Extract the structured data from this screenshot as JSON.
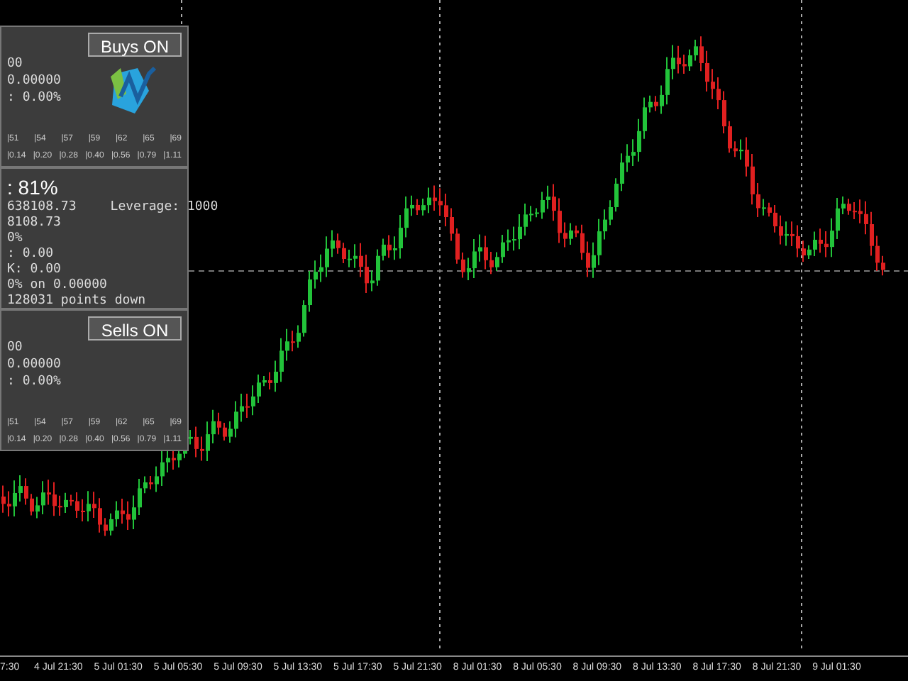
{
  "panels": [
    {
      "kind": "levels",
      "button": "Buys ON",
      "lines": [
        "00",
        "0.00000",
        ": 0.00%"
      ],
      "levels": [
        "|51",
        "|54",
        "|57",
        "|59",
        "|62",
        "|65",
        "|69"
      ],
      "values": [
        "|0.14",
        "|0.20",
        "|0.28",
        "|0.40",
        "|0.56",
        "|0.79",
        "|1.11"
      ]
    },
    {
      "kind": "account",
      "headline": ": 81%",
      "leverage": "Leverage: 1000",
      "lines": [
        "638108.73",
        "8108.73",
        "0%",
        ": 0.00",
        "K: 0.00",
        "0% on 0.00000",
        "128031 points down"
      ]
    },
    {
      "kind": "levels",
      "button": "Sells ON",
      "lines": [
        "00",
        "0.00000",
        ": 0.00%"
      ],
      "levels": [
        "|51",
        "|54",
        "|57",
        "|59",
        "|62",
        "|65",
        "|69"
      ],
      "values": [
        "|0.14",
        "|0.20",
        "|0.28",
        "|0.40",
        "|0.56",
        "|0.79",
        "|1.11"
      ]
    }
  ],
  "time_axis": [
    "7:30",
    "4 Jul 21:30",
    "5 Jul 01:30",
    "5 Jul 05:30",
    "5 Jul 09:30",
    "5 Jul 13:30",
    "5 Jul 17:30",
    "5 Jul 21:30",
    "8 Jul 01:30",
    "8 Jul 05:30",
    "8 Jul 09:30",
    "8 Jul 13:30",
    "8 Jul 17:30",
    "8 Jul 21:30",
    "9 Jul 01:30"
  ]
}
